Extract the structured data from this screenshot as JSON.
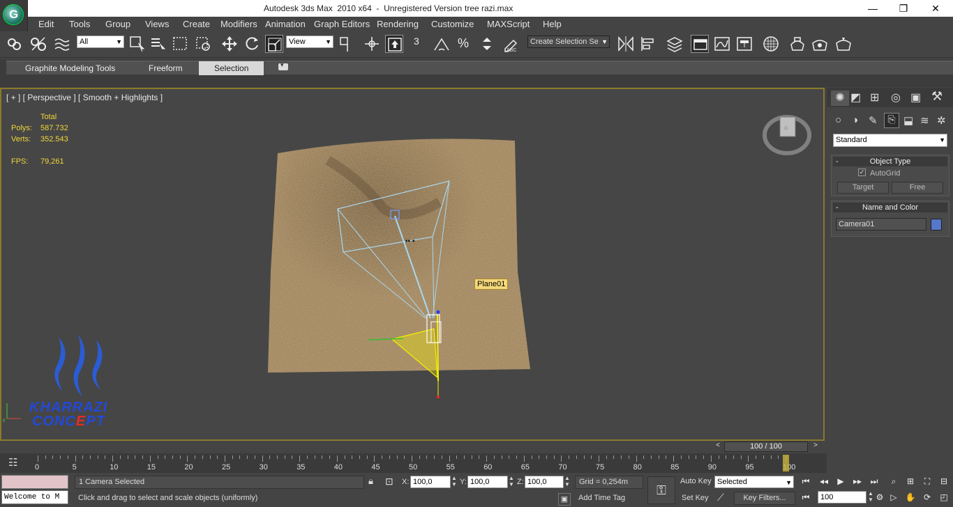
{
  "window": {
    "title": "Autodesk 3ds Max  2010 x64  -  Unregistered Version",
    "file": "tree razi.max",
    "minimize": "—",
    "maximize": "❐",
    "close": "✕"
  },
  "menu": [
    "Edit",
    "Tools",
    "Group",
    "Views",
    "Create",
    "Modifiers",
    "Animation",
    "Graph Editors",
    "Rendering",
    "Customize",
    "MAXScript",
    "Help"
  ],
  "toolbar": {
    "selection_filter": "All",
    "ref_coord": "View",
    "named_selection_placeholder": "Create Selection Se",
    "snap_label": "3"
  },
  "ribbon": {
    "tabs": [
      "Graphite Modeling Tools",
      "Freeform",
      "Selection"
    ],
    "active_tab": "Selection"
  },
  "viewport": {
    "label": "[ + ] [ Perspective ] [ Smooth + Highlights ]",
    "stats": {
      "total_label": "Total",
      "polys_label": "Polys:",
      "polys_value": "587.732",
      "verts_label": "Verts:",
      "verts_value": "352.543",
      "fps_label": "FPS:",
      "fps_value": "79,261"
    },
    "object_tag": "Plane01",
    "watermark_line1": "KHARRAZI",
    "watermark_line2a": "CONC",
    "watermark_line2b": "E",
    "watermark_line2c": "PT",
    "colors": {
      "border": "#8a7a2a",
      "sand": "#8a6e4a",
      "camera": "#a8d8f0",
      "selected": "#f5f000"
    }
  },
  "command_panel": {
    "dropdown": "Standard",
    "object_type": {
      "header": "Object Type",
      "autogrid": "AutoGrid",
      "buttons": [
        "Target",
        "Free"
      ]
    },
    "name_color": {
      "header": "Name and Color",
      "name": "Camera01",
      "swatch": "#5577cc"
    }
  },
  "timeline": {
    "frame_display": "100 / 100",
    "ticks": [
      "0",
      "5",
      "10",
      "15",
      "20",
      "25",
      "30",
      "35",
      "40",
      "45",
      "50",
      "55",
      "60",
      "65",
      "70",
      "75",
      "80",
      "85",
      "90",
      "95",
      "100"
    ],
    "current_frame": 100
  },
  "status": {
    "listener": "Welcome to M",
    "selected_info": "1 Camera Selected",
    "prompt": "Click and drag to select and scale objects (uniformly)",
    "x_label": "X:",
    "x_value": "100,0",
    "y_label": "Y:",
    "y_value": "100,0",
    "z_label": "Z:",
    "z_value": "100,0",
    "grid": "Grid = 0,254m",
    "add_time_tag": "Add Time Tag",
    "auto_key": "Auto Key",
    "set_key": "Set Key",
    "key_mode": "Selected",
    "key_filters": "Key Filters...",
    "frame_field": "100"
  }
}
